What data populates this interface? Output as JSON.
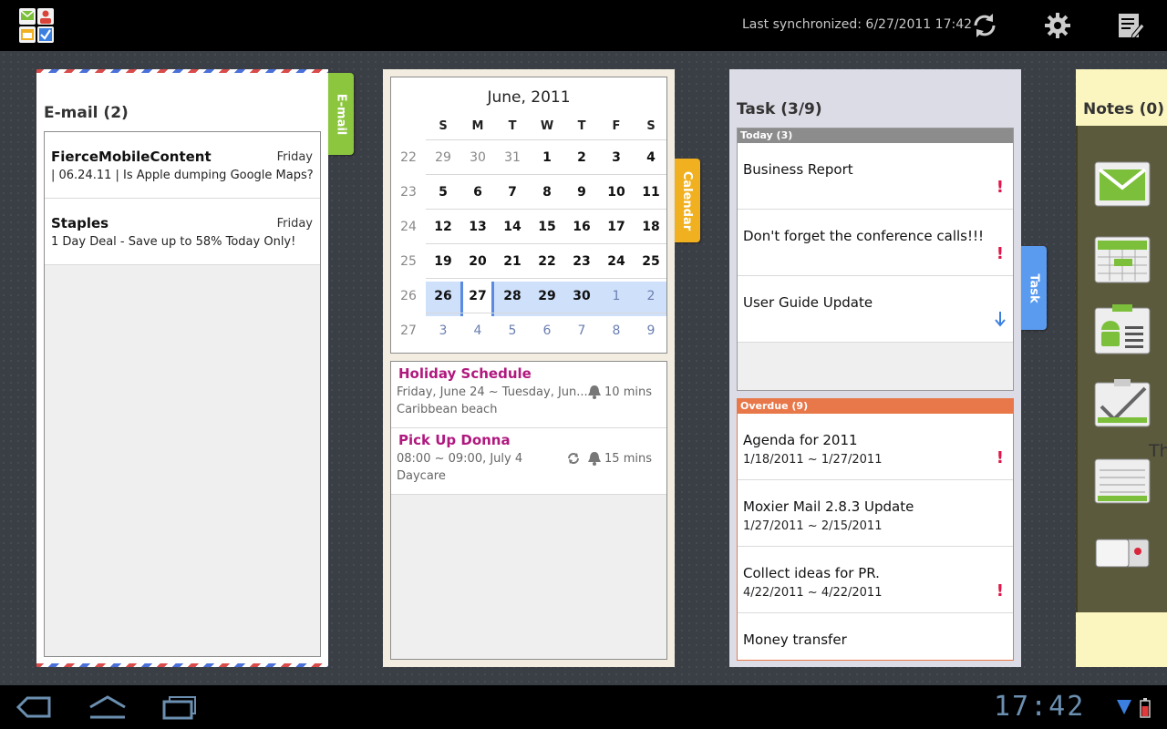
{
  "topbar": {
    "app_icon": "moxier-app-icon",
    "sync_label": "Last synchronized: 6/27/2011 17:42",
    "icons": [
      "sync-icon",
      "settings-gear-icon",
      "compose-note-icon"
    ]
  },
  "email": {
    "tab_label": "E-mail",
    "title": "E-mail (2)",
    "items": [
      {
        "sender": "FierceMobileContent",
        "date": "Friday",
        "subject": "| 06.24.11 | Is Apple dumping Google Maps?"
      },
      {
        "sender": "Staples",
        "date": "Friday",
        "subject": "1 Day Deal - Save up to 58% Today Only!"
      }
    ]
  },
  "calendar": {
    "tab_label": "Calendar",
    "month_title": "June, 2011",
    "weekdays": [
      "S",
      "M",
      "T",
      "W",
      "T",
      "F",
      "S"
    ],
    "weeks": [
      {
        "num": "22",
        "days": [
          "29",
          "30",
          "31",
          "1",
          "2",
          "3",
          "4"
        ]
      },
      {
        "num": "23",
        "days": [
          "5",
          "6",
          "7",
          "8",
          "9",
          "10",
          "11"
        ]
      },
      {
        "num": "24",
        "days": [
          "12",
          "13",
          "14",
          "15",
          "16",
          "17",
          "18"
        ]
      },
      {
        "num": "25",
        "days": [
          "19",
          "20",
          "21",
          "22",
          "23",
          "24",
          "25"
        ]
      },
      {
        "num": "26",
        "days": [
          "26",
          "27",
          "28",
          "29",
          "30",
          "1",
          "2"
        ]
      },
      {
        "num": "27",
        "days": [
          "3",
          "4",
          "5",
          "6",
          "7",
          "8",
          "9"
        ]
      }
    ],
    "events": [
      {
        "title": "Holiday Schedule",
        "time": "Friday, June 24 ~ Tuesday, Jun...",
        "location": "Caribbean beach",
        "reminder": "10 mins",
        "recurring": false
      },
      {
        "title": "Pick Up Donna",
        "time": "08:00 ~ 09:00, July 4",
        "location": "Daycare",
        "reminder": "15 mins",
        "recurring": true
      }
    ],
    "colors": {
      "event_title": "#b0187e",
      "selected_week": "#cfe0fb",
      "tab": "#f0b020"
    }
  },
  "tasks": {
    "tab_label": "Task",
    "title": "Task (3/9)",
    "today_header": "Today (3)",
    "today": [
      {
        "name": "Business Report",
        "priority": "high"
      },
      {
        "name": "Don't forget the conference calls!!!",
        "priority": "high"
      },
      {
        "name": "User Guide Update",
        "priority": "low"
      }
    ],
    "overdue_header": "Overdue (9)",
    "overdue": [
      {
        "name": "Agenda for 2011",
        "dates": "1/18/2011 ~ 1/27/2011",
        "priority": "high"
      },
      {
        "name": "Moxier Mail 2.8.3 Update",
        "dates": "1/27/2011 ~ 2/15/2011",
        "priority": ""
      },
      {
        "name": "Collect ideas for PR.",
        "dates": "4/22/2011 ~ 4/22/2011",
        "priority": "high"
      },
      {
        "name": "Money transfer",
        "dates": "",
        "priority": ""
      }
    ],
    "colors": {
      "today_header": "#8c8c8c",
      "overdue_header": "#e8784a",
      "high_priority": "#e0154a",
      "tab": "#5a9bf0"
    }
  },
  "notes": {
    "title": "Notes (0)",
    "dock_icons": [
      "mail-app-icon",
      "calendar-app-icon",
      "android-contacts-icon",
      "tasks-checklist-icon",
      "notes-pad-icon",
      "toggle-switch-icon"
    ],
    "overflow_text": "Th"
  },
  "system": {
    "clock": "17:42",
    "nav_icons": [
      "back-icon",
      "home-icon",
      "recent-apps-icon"
    ],
    "status_icons": [
      "wifi-signal-icon",
      "battery-icon"
    ]
  }
}
